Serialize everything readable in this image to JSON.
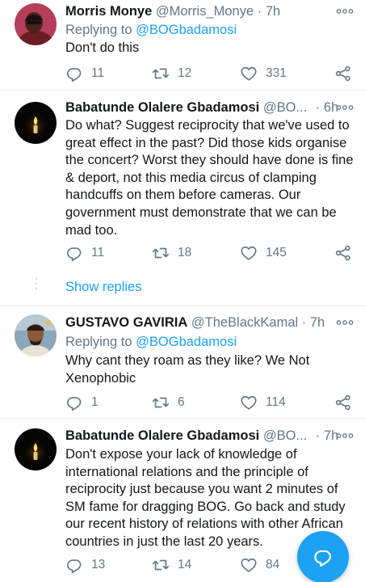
{
  "tweets": [
    {
      "name": "Morris Monye",
      "handle": "@Morris_Monye",
      "time": "7h",
      "reply_prefix": "Replying to",
      "reply_mention": "@BOGbadamosi",
      "lines": [
        "Don't do this"
      ],
      "replies": "11",
      "retweets": "12",
      "likes": "331"
    },
    {
      "name": "Babatunde Olalere Gbadamosi",
      "handle": "@BO...",
      "time": "6h",
      "lines": [
        "Do what? Suggest reciprocity that we've used to",
        "great effect in the past? Did those kids organise",
        "the concert? Worst they should have done is fine",
        "& deport, not this media circus of clamping",
        "handcuffs on them before cameras. Our",
        "government must demonstrate that we can be",
        "mad too."
      ],
      "replies": "11",
      "retweets": "18",
      "likes": "145"
    },
    {
      "name": "GUSTAVO GAVIRIA",
      "handle": "@TheBlackKamal",
      "time": "7h",
      "reply_prefix": "Replying to",
      "reply_mention": "@BOGbadamosi",
      "lines": [
        "Why cant they roam as they like? We Not",
        "Xenophobic"
      ],
      "replies": "1",
      "retweets": "6",
      "likes": "114"
    },
    {
      "name": "Babatunde Olalere Gbadamosi",
      "handle": "@BO...",
      "time": "7h",
      "lines": [
        "Don't expose your lack of knowledge of",
        "international relations and the principle of",
        "reciprocity just because you want 2 minutes of",
        "SM fame for dragging BOG. Go back and study",
        "our recent history of relations with other African",
        "countries in just the last 20 years."
      ],
      "replies": "13",
      "retweets": "14",
      "likes": "84"
    }
  ],
  "separator": "·",
  "show_replies": "Show replies",
  "colors": {
    "accent": "#1da1f2",
    "secondary_text": "#657786",
    "divider": "#e6ecf0"
  },
  "icons": [
    "more-icon",
    "reply-icon",
    "retweet-icon",
    "like-icon",
    "share-icon",
    "compose-reply-icon"
  ]
}
